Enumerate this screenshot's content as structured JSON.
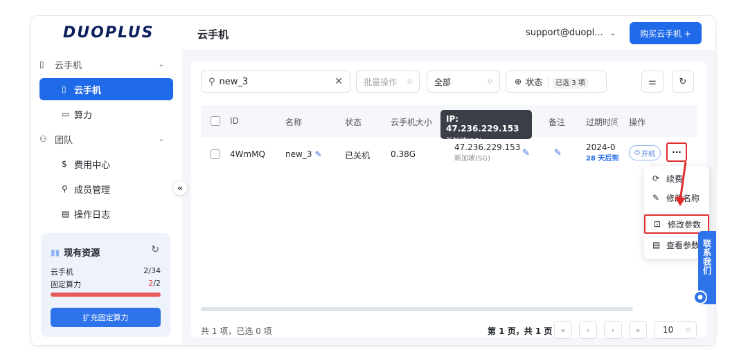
{
  "brand": {
    "logo": "DUOPLUS"
  },
  "sidebar": {
    "group_cloud": {
      "label": "云手机",
      "icon": "phone-icon"
    },
    "active_item": {
      "label": "云手机",
      "icon": "phone-icon"
    },
    "compute_item": {
      "label": "算力",
      "icon": "monitor-icon"
    },
    "group_team": {
      "label": "团队",
      "icon": "team-icon"
    },
    "team_items": [
      {
        "label": "费用中心",
        "icon": "dollar-icon"
      },
      {
        "label": "成员管理",
        "icon": "member-icon"
      },
      {
        "label": "操作日志",
        "icon": "log-icon"
      }
    ],
    "collapse_glyph": "«",
    "resources": {
      "title": "现有资源",
      "rows": [
        {
          "label": "云手机",
          "value": "2/34"
        },
        {
          "label": "固定算力",
          "value_a": "2",
          "value_b": "/2"
        }
      ],
      "expand_button": "扩充固定算力",
      "usage_fraction": 1.0
    }
  },
  "header": {
    "title": "云手机",
    "account": "support@duopl...",
    "buy_button": "购买云手机 +"
  },
  "toolbar": {
    "search_value": "new_3",
    "bulk_select": "批量操作",
    "filter_select": "全部",
    "status_label": "状态",
    "selected_tag_prefix": "已选",
    "selected_tag_count": "3 项"
  },
  "table": {
    "headers": [
      "ID",
      "名称",
      "状态",
      "云手机大小",
      "备注",
      "过期时间",
      "操作"
    ],
    "rows": [
      {
        "id": "4WmMQ",
        "name": "new_3",
        "status": "已关机",
        "size": "0.38G",
        "ip": "47.236.229.153",
        "region": "新加坡(SG)",
        "expire": "2024-0",
        "expire_hint": "28 天后到",
        "power_button": "开机",
        "more_button": "···"
      }
    ]
  },
  "tooltip": {
    "ip": "IP: 47.236.229.153",
    "region": "新加坡(SG)"
  },
  "dropdown": {
    "items": [
      {
        "label": "续费",
        "icon": "renew-icon"
      },
      {
        "label": "修改名称",
        "icon": "edit-icon"
      },
      {
        "label": "修改参数",
        "icon": "params-icon"
      },
      {
        "label": "查看参数",
        "icon": "document-icon"
      }
    ]
  },
  "footer": {
    "total": "共 1 项，已选 0 项",
    "page_text": "第 1 页，共 1 页",
    "page_size": "10"
  },
  "contact": {
    "label": "联系我们"
  },
  "colors": {
    "primary": "#1f6ae8",
    "highlight": "#e02e2e",
    "logo": "#0b1f5c"
  }
}
